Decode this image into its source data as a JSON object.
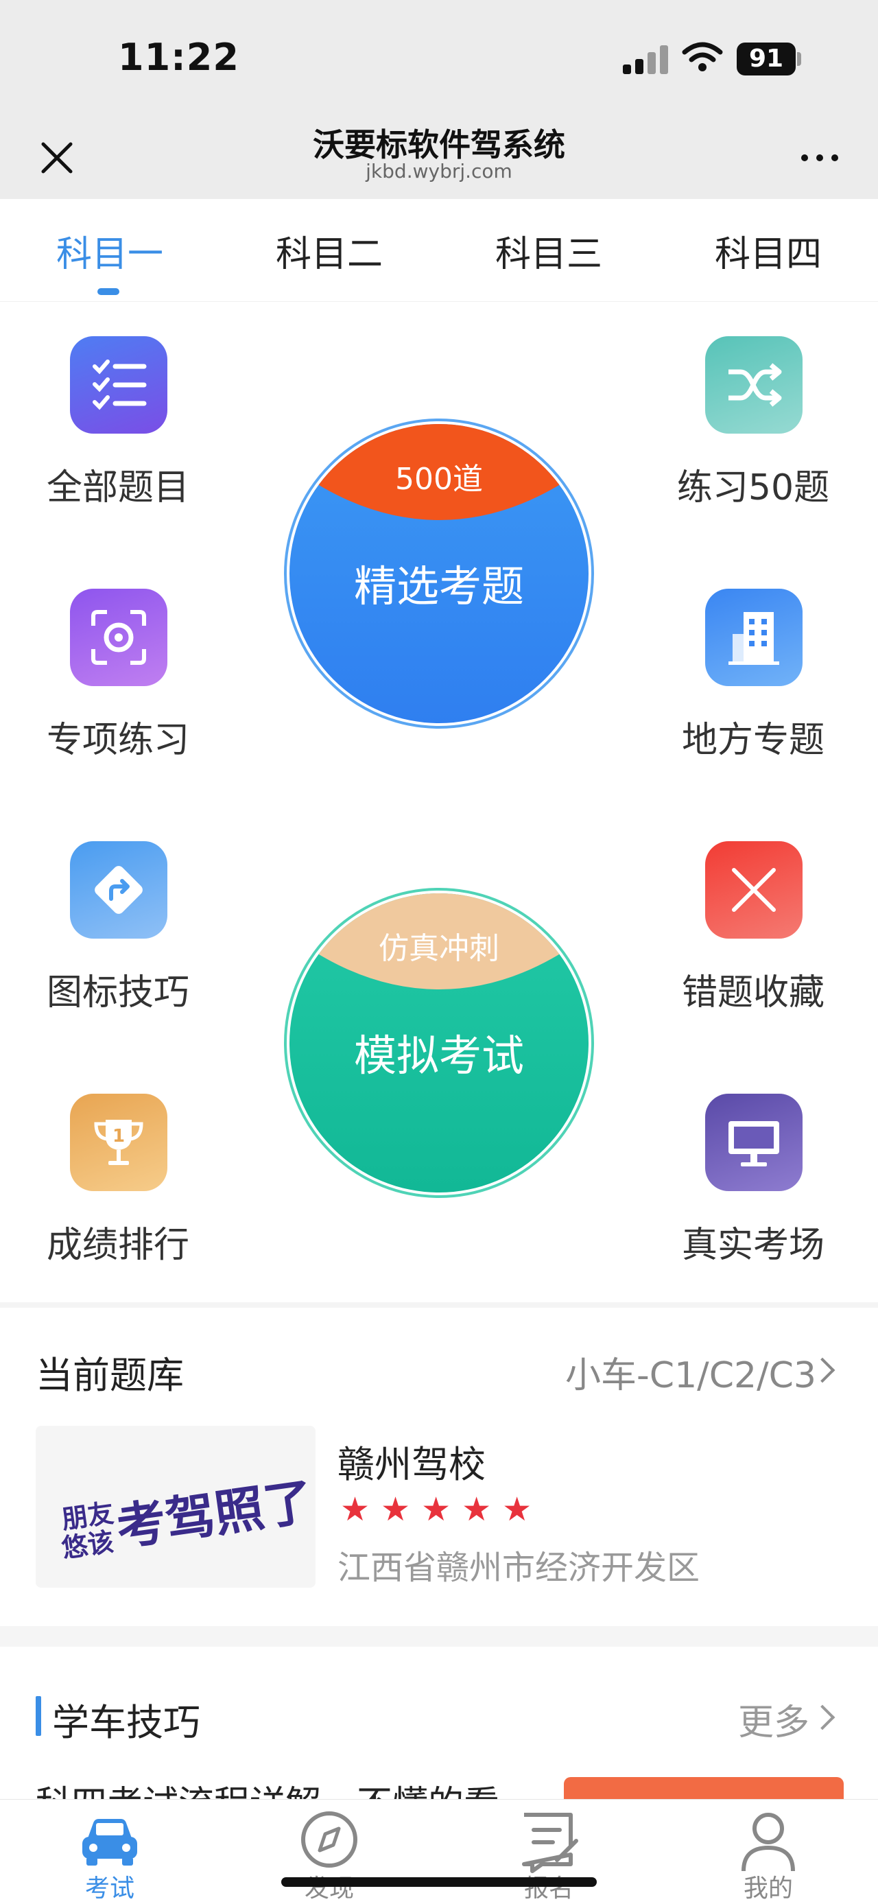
{
  "status_bar": {
    "time": "11:22",
    "battery": "91"
  },
  "nav": {
    "title": "沃要标软件驾系统",
    "subtitle": "jkbd.wybrj.com"
  },
  "tabs": [
    {
      "label": "科目一",
      "active": true
    },
    {
      "label": "科目二",
      "active": false
    },
    {
      "label": "科目三",
      "active": false
    },
    {
      "label": "科目四",
      "active": false
    }
  ],
  "grid": {
    "all_questions": "全部题目",
    "practice_50": "练习50题",
    "special_practice": "专项练习",
    "local_topics": "地方专题",
    "sign_tips": "图标技巧",
    "wrong_favorites": "错题收藏",
    "score_ranking": "成绩排行",
    "real_exam_room": "真实考场"
  },
  "featured": {
    "cap": "500道",
    "label": "精选考题"
  },
  "mock_exam": {
    "cap": "仿真冲刺",
    "label": "模拟考试"
  },
  "question_bank": {
    "title": "当前题库",
    "type": "小车-C1/C2/C3",
    "school_name": "赣州驾校",
    "rating": 5,
    "address": "江西省赣州市经济开发区",
    "logo_text": "朋友悠该考驾照了!"
  },
  "tips": {
    "title": "学车技巧",
    "more": "更多",
    "article_peek": "科四考试流程详解，不懂的看"
  },
  "tab_bar": [
    {
      "label": "考试",
      "icon": "car-icon",
      "active": true
    },
    {
      "label": "发现",
      "icon": "compass-icon",
      "active": false
    },
    {
      "label": "报名",
      "icon": "form-icon",
      "active": false
    },
    {
      "label": "我的",
      "icon": "person-icon",
      "active": false
    }
  ],
  "colors": {
    "accent": "#3a8ee6",
    "featured_blue": "#3d8cf0",
    "featured_cap": "#f2551c",
    "mock_green": "#1fc1a0",
    "mock_cap": "#f0c99e",
    "star": "#e8323c"
  }
}
